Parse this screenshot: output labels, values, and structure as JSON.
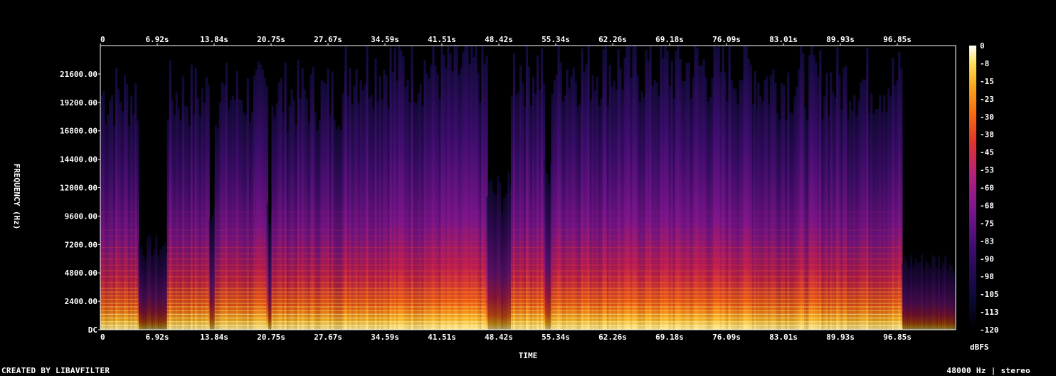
{
  "chart_data": {
    "type": "heatmap",
    "title": "",
    "xlabel": "TIME",
    "ylabel": "FREQUENCY (Hz)",
    "x_ticks": [
      "0",
      "6.92s",
      "13.84s",
      "20.75s",
      "27.67s",
      "34.59s",
      "41.51s",
      "48.42s",
      "55.34s",
      "62.26s",
      "69.18s",
      "76.09s",
      "83.01s",
      "89.93s",
      "96.85s"
    ],
    "x_range_s": [
      0,
      103.8
    ],
    "y_ticks": [
      "DC",
      "2400.00",
      "4800.00",
      "7200.00",
      "9600.00",
      "12000.00",
      "14400.00",
      "16800.00",
      "19200.00",
      "21600.00"
    ],
    "y_range_hz": [
      0,
      24000
    ],
    "colorbar_label": "dBFS",
    "colorbar_ticks": [
      "0",
      "-8",
      "-15",
      "-23",
      "-30",
      "-38",
      "-45",
      "-53",
      "-60",
      "-68",
      "-75",
      "-83",
      "-90",
      "-98",
      "-105",
      "-113",
      "-120"
    ],
    "colorbar_range_db": [
      -120,
      0
    ],
    "colormap": [
      "#000000",
      "#0d0a3a",
      "#3b0c6e",
      "#7a1590",
      "#b8207a",
      "#e3342c",
      "#f96a10",
      "#fba91c",
      "#fde15a",
      "#ffffff"
    ],
    "activity_segments_s": [
      {
        "start": 0.0,
        "end": 4.6,
        "level": 0.85
      },
      {
        "start": 4.6,
        "end": 8.1,
        "level": 0.3
      },
      {
        "start": 8.1,
        "end": 13.2,
        "level": 0.85
      },
      {
        "start": 13.2,
        "end": 13.9,
        "level": 0.45
      },
      {
        "start": 13.9,
        "end": 20.2,
        "level": 0.85
      },
      {
        "start": 20.2,
        "end": 20.8,
        "level": 0.45
      },
      {
        "start": 20.8,
        "end": 29.7,
        "level": 0.85
      },
      {
        "start": 29.7,
        "end": 46.9,
        "level": 0.95
      },
      {
        "start": 46.9,
        "end": 49.9,
        "level": 0.5
      },
      {
        "start": 49.9,
        "end": 53.9,
        "level": 0.95
      },
      {
        "start": 53.9,
        "end": 54.8,
        "level": 0.55
      },
      {
        "start": 54.8,
        "end": 79.6,
        "level": 0.95
      },
      {
        "start": 79.6,
        "end": 97.4,
        "level": 0.9
      },
      {
        "start": 97.4,
        "end": 103.8,
        "level": 0.25
      }
    ]
  },
  "footer": {
    "left": "CREATED BY LIBAVFILTER",
    "right": "48000 Hz | stereo"
  }
}
